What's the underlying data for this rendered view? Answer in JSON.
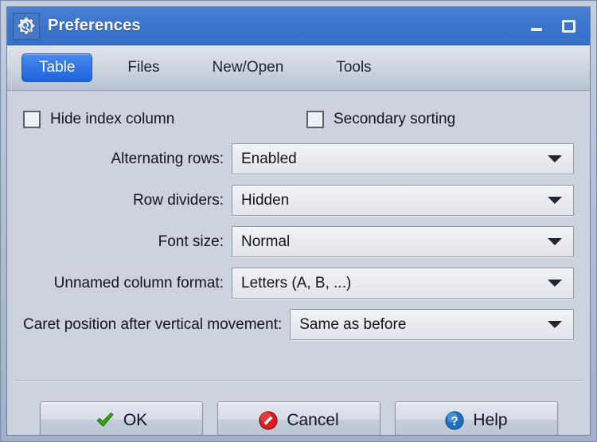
{
  "window": {
    "title": "Preferences",
    "icon": "preferences-gear-wrench-icon",
    "controls": {
      "minimize_label": "Minimize",
      "maximize_label": "Maximize"
    },
    "accent_color": "#3670c9",
    "body_color": "#ccd3de"
  },
  "tabs": {
    "items": [
      {
        "label": "Table",
        "active": true
      },
      {
        "label": "Files",
        "active": false
      },
      {
        "label": "New/Open",
        "active": false
      },
      {
        "label": "Tools",
        "active": false
      }
    ],
    "active_color": "#2f74e3"
  },
  "table_page": {
    "checkboxes": [
      {
        "label": "Hide index column",
        "checked": false
      },
      {
        "label": "Secondary sorting",
        "checked": false
      }
    ],
    "fields": [
      {
        "label": "Alternating rows:",
        "value": "Enabled"
      },
      {
        "label": "Row dividers:",
        "value": "Hidden"
      },
      {
        "label": "Font size:",
        "value": "Normal"
      },
      {
        "label": "Unnamed column format:",
        "value": "Letters (A, B, ...)"
      },
      {
        "label": "Caret position after vertical movement:",
        "value": "Same as before"
      }
    ]
  },
  "buttons": [
    {
      "label": "OK",
      "icon": "green-check-icon"
    },
    {
      "label": "Cancel",
      "icon": "red-cancel-icon"
    },
    {
      "label": "Help",
      "icon": "blue-question-icon"
    }
  ]
}
